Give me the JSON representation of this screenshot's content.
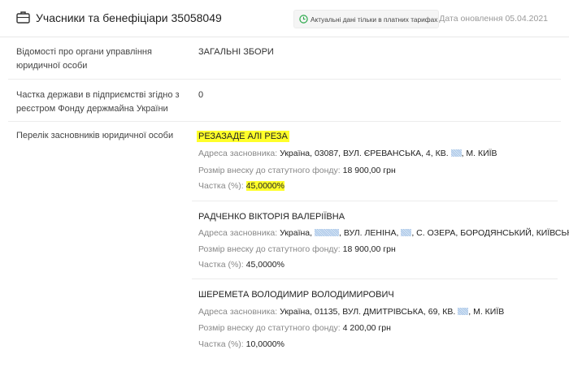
{
  "header": {
    "title": "Учасники та бенефіціари 35058049",
    "paid_notice": "Актуальні дані тільки в платних тарифах",
    "update_date": "Дата оновлення 05.04.2021"
  },
  "rows": {
    "management": {
      "label": "Відомості про органи управління юридичної особи",
      "value": "ЗАГАЛЬНІ ЗБОРИ"
    },
    "state_share": {
      "label": "Частка держави в підприємстві згідно з реєстром Фонду держмайна України",
      "value": "0"
    },
    "founders": {
      "label": "Перелік засновників юридичної особи"
    }
  },
  "field_labels": {
    "address": "Адреса засновника:",
    "contribution": "Розмір внеску до статутного фонду:",
    "share": "Частка (%):"
  },
  "founders": [
    {
      "name": "РЕЗАЗАДЕ АЛІ РЕЗА",
      "address_a": "Україна, 03087, ВУЛ. ЄРЕВАНСЬКА, 4, КВ.",
      "address_b": ", М. КИЇВ",
      "contribution": "18 900,00 грн",
      "share": "45,0000%"
    },
    {
      "name": "РАДЧЕНКО ВІКТОРІЯ ВАЛЕРІЇВНА",
      "address_a": "Україна,",
      "address_b": ", ВУЛ. ЛЕНІНА,",
      "address_c": ", С. ОЗЕРА, БОРОДЯНСЬКИЙ, КИЇВСЬКА",
      "contribution": "18 900,00 грн",
      "share": "45,0000%"
    },
    {
      "name": "ШЕРЕМЕТА ВОЛОДИМИР ВОЛОДИМИРОВИЧ",
      "address_a": "Україна, 01135, ВУЛ. ДМИТРІВСЬКА, 69, КВ.",
      "address_b": ", М. КИЇВ",
      "contribution": "4 200,00 грн",
      "share": "10,0000%"
    }
  ]
}
